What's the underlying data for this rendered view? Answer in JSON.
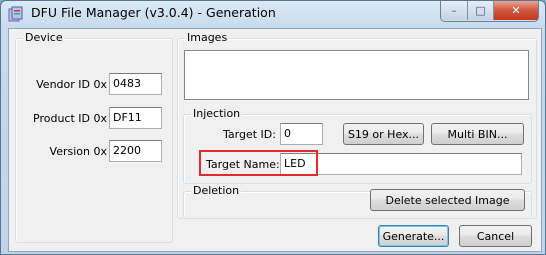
{
  "window": {
    "title": "DFU File Manager (v3.0.4) - Generation",
    "controls": {
      "minimize": "–",
      "maximize": "□",
      "close": "✕"
    }
  },
  "device": {
    "legend": "Device",
    "vendor_label": "Vendor ID 0x",
    "vendor_value": "0483",
    "product_label": "Product ID 0x",
    "product_value": "DF11",
    "version_label": "Version 0x",
    "version_value": "2200"
  },
  "images": {
    "legend": "Images",
    "items": []
  },
  "injection": {
    "legend": "Injection",
    "target_id_label": "Target ID:",
    "target_id_value": "0",
    "s19_button": "S19 or Hex...",
    "multibin_button": "Multi BIN...",
    "target_name_label": "Target Name:",
    "target_name_value": "LED"
  },
  "deletion": {
    "legend": "Deletion",
    "delete_button": "Delete selected Image"
  },
  "footer": {
    "generate_button": "Generate...",
    "cancel_button": "Cancel"
  },
  "colors": {
    "highlight": "#e02c2c",
    "close_button": "#c2381d"
  }
}
